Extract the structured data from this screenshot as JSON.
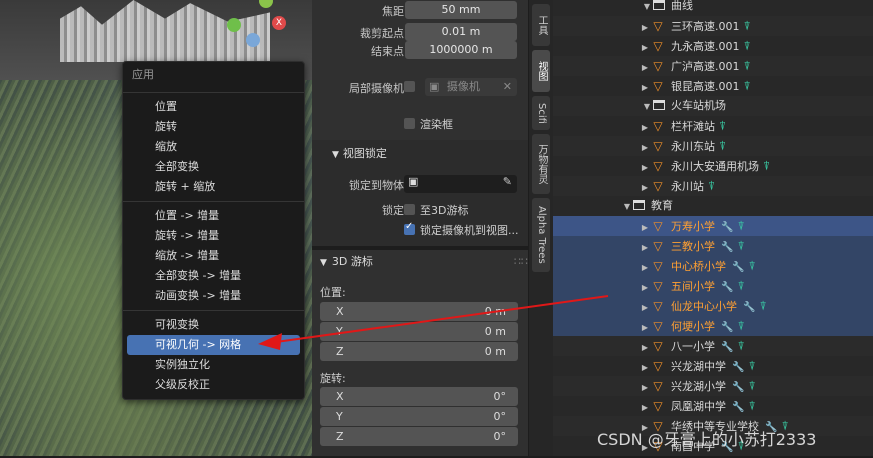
{
  "menu": {
    "title": "应用",
    "group1": [
      "位置",
      "旋转",
      "缩放",
      "全部变换",
      "旋转 + 缩放"
    ],
    "group2": [
      "位置 -> 增量",
      "旋转 -> 增量",
      "缩放 -> 增量",
      "全部变换 -> 增量",
      "动画变换 -> 增量"
    ],
    "group3": [
      "可视变换",
      "可视几何 -> 网格",
      "实例独立化",
      "父级反校正"
    ],
    "active_item": "可视几何 -> 网格"
  },
  "props": {
    "focal_label": "焦距",
    "focal_value": "50 mm",
    "clip_start_label": "裁剪起点",
    "clip_start_value": "0.01 m",
    "clip_end_label": "结束点",
    "clip_end_value": "1000000 m",
    "local_camera_label": "局部摄像机",
    "local_camera_value": "摄像机",
    "render_border_label": "渲染框",
    "view_lock_header": "视图锁定",
    "lock_to_object_label": "锁定到物体",
    "lock_label": "锁定",
    "lock_cursor_label": "至3D游标",
    "lock_camera_label": "锁定摄像机到视图...",
    "cursor_header": "3D 游标",
    "location_label": "位置:",
    "loc": [
      {
        "k": "X",
        "v": "0 m"
      },
      {
        "k": "Y",
        "v": "0 m"
      },
      {
        "k": "Z",
        "v": "0 m"
      }
    ],
    "rotation_label": "旋转:",
    "rot": [
      {
        "k": "X",
        "v": "0°"
      },
      {
        "k": "Y",
        "v": "0°"
      },
      {
        "k": "Z",
        "v": "0°"
      }
    ]
  },
  "tabs": [
    "工具",
    "视图",
    "Scifi",
    "万物有灵",
    "Alpha Trees"
  ],
  "outliner": {
    "rows": [
      {
        "label": "曲线",
        "indent": 1,
        "type": "collection"
      },
      {
        "label": "三环高速.001",
        "indent": 2,
        "type": "object",
        "tree": true
      },
      {
        "label": "九永高速.001",
        "indent": 2,
        "type": "object",
        "tree": true
      },
      {
        "label": "广泸高速.001",
        "indent": 2,
        "type": "object",
        "tree": true
      },
      {
        "label": "银昆高速.001",
        "indent": 2,
        "type": "object",
        "tree": true
      },
      {
        "label": "火车站机场",
        "indent": 1,
        "type": "collection"
      },
      {
        "label": "栏杆滩站",
        "indent": 2,
        "type": "object",
        "tree": true
      },
      {
        "label": "永川东站",
        "indent": 2,
        "type": "object",
        "tree": true
      },
      {
        "label": "永川大安通用机场",
        "indent": 2,
        "type": "object",
        "tree": true
      },
      {
        "label": "永川站",
        "indent": 2,
        "type": "object",
        "tree": true
      },
      {
        "label": "教育",
        "indent": 0,
        "type": "collection"
      },
      {
        "label": "万寿小学",
        "indent": 2,
        "type": "object",
        "mod": true,
        "tree": true,
        "sel": "first"
      },
      {
        "label": "三教小学",
        "indent": 2,
        "type": "object",
        "mod": true,
        "tree": true,
        "sel": "yes"
      },
      {
        "label": "中心桥小学",
        "indent": 2,
        "type": "object",
        "mod": true,
        "tree": true,
        "sel": "yes"
      },
      {
        "label": "五间小学",
        "indent": 2,
        "type": "object",
        "mod": true,
        "tree": true,
        "sel": "yes"
      },
      {
        "label": "仙龙中心小学",
        "indent": 2,
        "type": "object",
        "mod": true,
        "tree": true,
        "sel": "yes"
      },
      {
        "label": "何埂小学",
        "indent": 2,
        "type": "object",
        "mod": true,
        "tree": true,
        "sel": "yes"
      },
      {
        "label": "八一小学",
        "indent": 2,
        "type": "object",
        "mod": true,
        "tree": true
      },
      {
        "label": "兴龙湖中学",
        "indent": 2,
        "type": "object",
        "mod": true,
        "tree": true
      },
      {
        "label": "兴龙湖小学",
        "indent": 2,
        "type": "object",
        "mod": true,
        "tree": true
      },
      {
        "label": "凤凰湖中学",
        "indent": 2,
        "type": "object",
        "mod": true,
        "tree": true
      },
      {
        "label": "华绣中等专业学校",
        "indent": 2,
        "type": "object",
        "mod": true,
        "tree": true
      },
      {
        "label": "南昌中学",
        "indent": 2,
        "type": "object",
        "mod": true,
        "tree": true
      }
    ]
  },
  "watermark": "CSDN @牙膏上的小苏打2333",
  "colors": {
    "accent": "#4772b3",
    "selected_text": "#ffa033",
    "arrow": "#e01818"
  }
}
